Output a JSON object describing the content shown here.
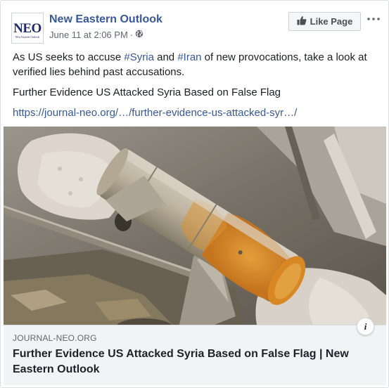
{
  "page": {
    "name": "New Eastern Outlook",
    "logo_text": "NEO",
    "logo_subtext": "New Eastern Outlook",
    "timestamp": "June 11 at 2:06 PM",
    "meta_separator": "·",
    "privacy_icon": "globe-icon",
    "like_button_label": "Like Page",
    "like_icon": "thumbs-up-icon",
    "more_icon": "more-options-icon"
  },
  "post": {
    "text_before_1": "As US seeks to accuse ",
    "hashtag_1": "#Syria",
    "text_between": " and ",
    "hashtag_2": "#Iran",
    "text_after": " of new provocations, take a look at verified lies behind past accusations.",
    "headline": "Further Evidence US Attacked Syria Based on False Flag",
    "url": "https://journal-neo.org/…/further-evidence-us-attacked-syr…/"
  },
  "link_preview": {
    "image_description_icon": "rocket-debris-photo",
    "info_label": "i",
    "domain": "JOURNAL-NEO.ORG",
    "title": "Further Evidence US Attacked Syria Based on False Flag | New Eastern Outlook"
  },
  "colors": {
    "link_blue": "#385898",
    "meta_gray": "#606770",
    "link_box_bg": "#f2f3f5",
    "logo_navy": "#1d2a6e",
    "rocket_orange": "#e8952a"
  }
}
